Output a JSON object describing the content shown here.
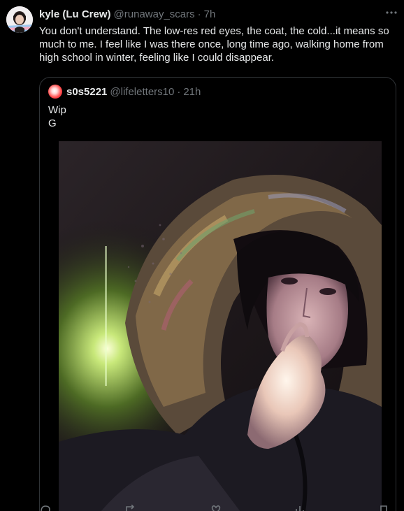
{
  "tweet": {
    "author_name": "kyle (Lu Crew)",
    "author_handle": "@runaway_scars",
    "separator": "·",
    "time": "7h",
    "text": "You don't understand. The low-res red eyes, the coat, the cold...it means so much to me. I feel like I was there once, long time ago, walking home from high school in winter, feeling like I could disappear.",
    "more_icon": "more-horizontal-icon"
  },
  "quote": {
    "author_name": "s0s5221",
    "author_handle": "@lifeletters10",
    "separator": "·",
    "time": "21h",
    "lines": [
      "Wip",
      "G"
    ],
    "media_icon": "artwork-image"
  },
  "actions": {
    "icons": [
      "reply-icon",
      "repost-icon",
      "like-icon",
      "views-icon",
      "bookmark-icon"
    ]
  },
  "colors": {
    "background": "#000000",
    "primary_text": "#e7e9ea",
    "secondary_text": "#71767b",
    "border": "#2f3336"
  }
}
